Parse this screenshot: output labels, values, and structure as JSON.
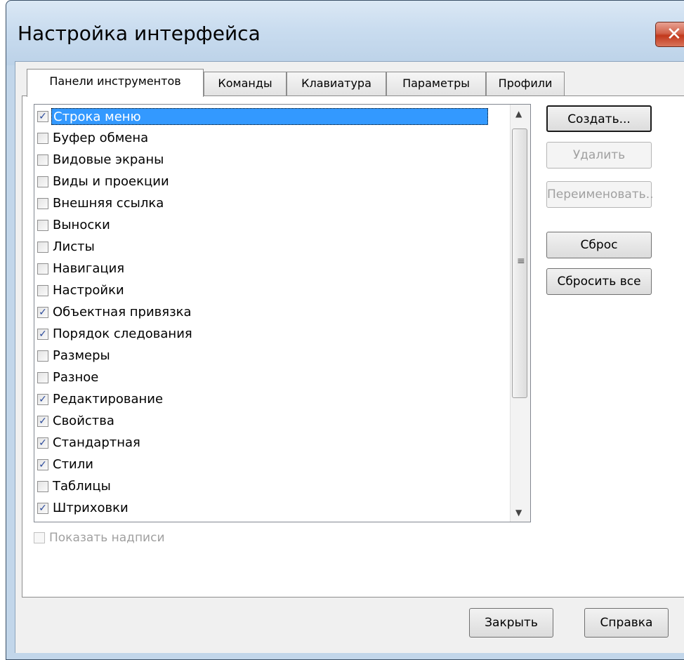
{
  "window": {
    "title": "Настройка интерфейса"
  },
  "tabs": [
    {
      "label": "Панели инструментов",
      "active": true
    },
    {
      "label": "Команды",
      "active": false
    },
    {
      "label": "Клавиатура",
      "active": false
    },
    {
      "label": "Параметры",
      "active": false
    },
    {
      "label": "Профили",
      "active": false
    }
  ],
  "toolbars": [
    {
      "label": "Строка меню",
      "checked": true,
      "selected": true
    },
    {
      "label": "Буфер обмена",
      "checked": false
    },
    {
      "label": "Видовые экраны",
      "checked": false
    },
    {
      "label": "Виды и проекции",
      "checked": false
    },
    {
      "label": "Внешняя ссылка",
      "checked": false
    },
    {
      "label": "Выноски",
      "checked": false
    },
    {
      "label": "Листы",
      "checked": false
    },
    {
      "label": "Навигация",
      "checked": false
    },
    {
      "label": "Настройки",
      "checked": false
    },
    {
      "label": "Объектная привязка",
      "checked": true
    },
    {
      "label": "Порядок следования",
      "checked": true
    },
    {
      "label": "Размеры",
      "checked": false
    },
    {
      "label": "Разное",
      "checked": false
    },
    {
      "label": "Редактирование",
      "checked": true
    },
    {
      "label": "Свойства",
      "checked": true
    },
    {
      "label": "Стандартная",
      "checked": true
    },
    {
      "label": "Стили",
      "checked": true
    },
    {
      "label": "Таблицы",
      "checked": false
    },
    {
      "label": "Штриховки",
      "checked": true
    }
  ],
  "buttons": {
    "create": "Создать...",
    "delete": "Удалить",
    "rename": "Переименовать..",
    "reset": "Сброс",
    "reset_all": "Сбросить все",
    "close": "Закрыть",
    "help": "Справка"
  },
  "show_labels": {
    "label": "Показать надписи",
    "checked": false,
    "enabled": false
  },
  "icons": {
    "close": "close-icon",
    "checkmark": "checkmark-icon"
  }
}
